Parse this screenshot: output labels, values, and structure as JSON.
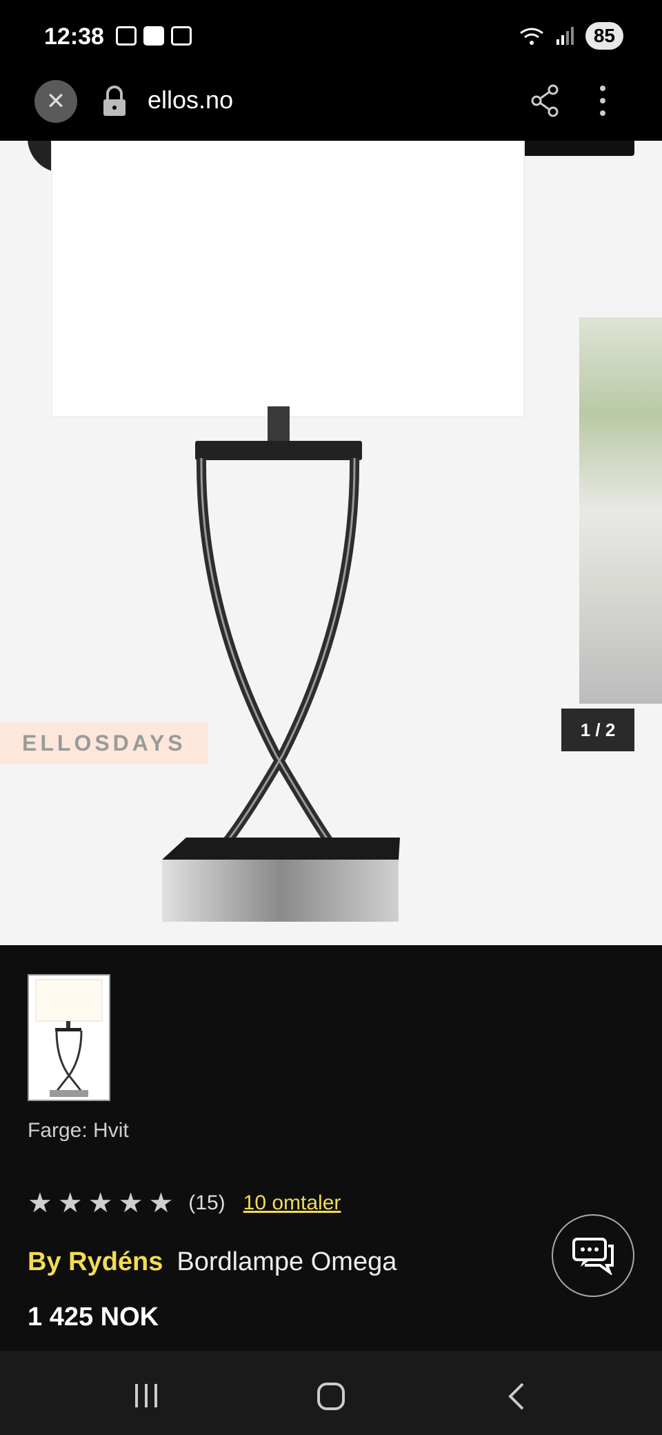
{
  "status_bar": {
    "time": "12:38",
    "battery": "85",
    "icons": [
      "screenshot-icon",
      "mail-icon",
      "calendar-icon",
      "wifi-icon",
      "signal-icon"
    ]
  },
  "browser": {
    "url": "ellos.no",
    "icons": [
      "close-icon",
      "lock-icon",
      "share-icon",
      "more-vert-icon"
    ]
  },
  "gallery": {
    "badge": "ELLOSDAYS",
    "counter": "1 / 2"
  },
  "product": {
    "color_label": "Farge: Hvit",
    "rating_count": "(15)",
    "reviews_link": "10 omtaler",
    "brand": "By Rydéns",
    "name": "Bordlampe Omega",
    "price": "1 425 NOK",
    "stars": 5
  },
  "colors": {
    "accent": "#f3dc55",
    "background": "#0e0e0e"
  }
}
